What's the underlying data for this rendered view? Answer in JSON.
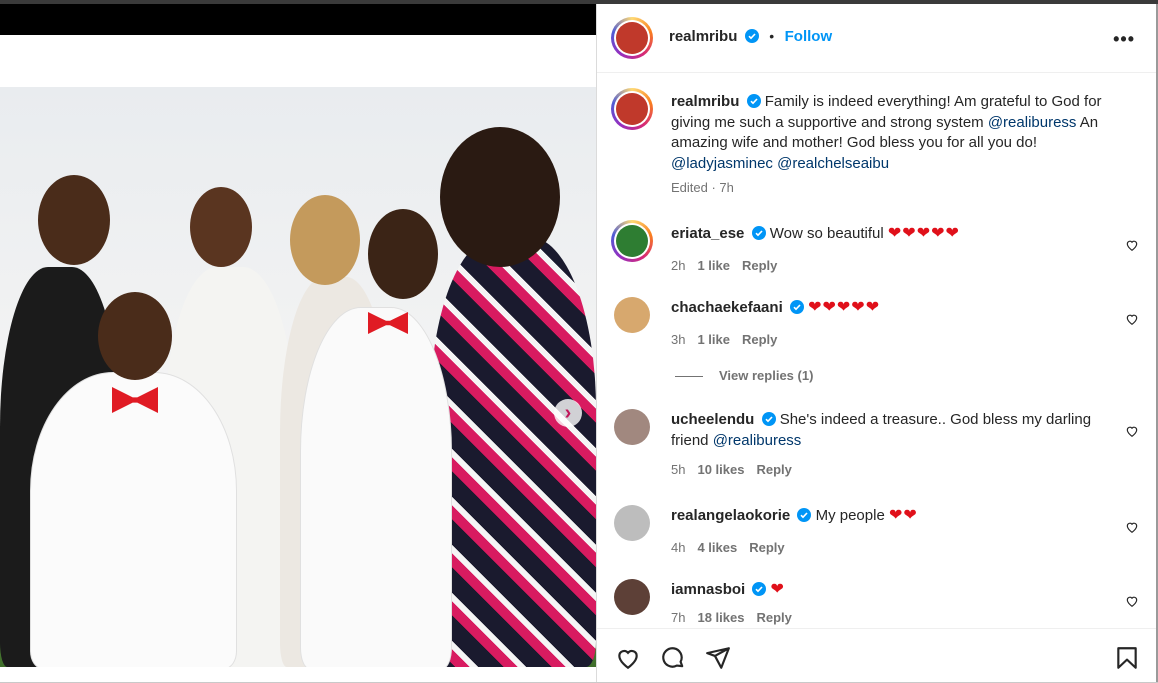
{
  "post": {
    "username": "realmribu",
    "follow_label": "Follow",
    "more_label": "•••",
    "caption_text": "Family is indeed everything! Am grateful to God for giving me such a supportive and strong system",
    "caption_mention1": "@realiburess",
    "caption_text2": "An amazing wife and mother! God bless you for all you do!",
    "caption_mention2": "@ladyjasminec",
    "caption_mention3": "@realchelseaibu",
    "caption_meta": "Edited · 7h"
  },
  "comments": [
    {
      "username": "eriata_ese",
      "text": "Wow so beautiful",
      "hearts": "❤❤❤❤❤",
      "time": "2h",
      "likes": "1 like",
      "reply": "Reply"
    },
    {
      "username": "chachaekefaani",
      "text": "",
      "hearts": "❤❤❤❤❤",
      "time": "3h",
      "likes": "1 like",
      "reply": "Reply"
    },
    {
      "username": "ucheelendu",
      "text": "She's indeed a treasure.. God bless my darling friend",
      "mention": "@realiburess",
      "time": "5h",
      "likes": "10 likes",
      "reply": "Reply"
    },
    {
      "username": "realangelaokorie",
      "text": "My people",
      "hearts": "❤❤",
      "time": "4h",
      "likes": "4 likes",
      "reply": "Reply"
    },
    {
      "username": "iamnasboi",
      "text": "",
      "hearts": "❤",
      "time": "7h",
      "likes": "18 likes",
      "reply": "Reply"
    }
  ],
  "view_replies_label": "View replies (1)",
  "colors": {
    "link": "#0095f6",
    "mention": "#00376b",
    "heart": "#e0101a",
    "meta": "#737373"
  },
  "icons": [
    "like-heart-icon",
    "comment-icon",
    "share-icon",
    "save-icon",
    "verified-badge-icon",
    "more-options-icon",
    "next-arrow-icon"
  ]
}
